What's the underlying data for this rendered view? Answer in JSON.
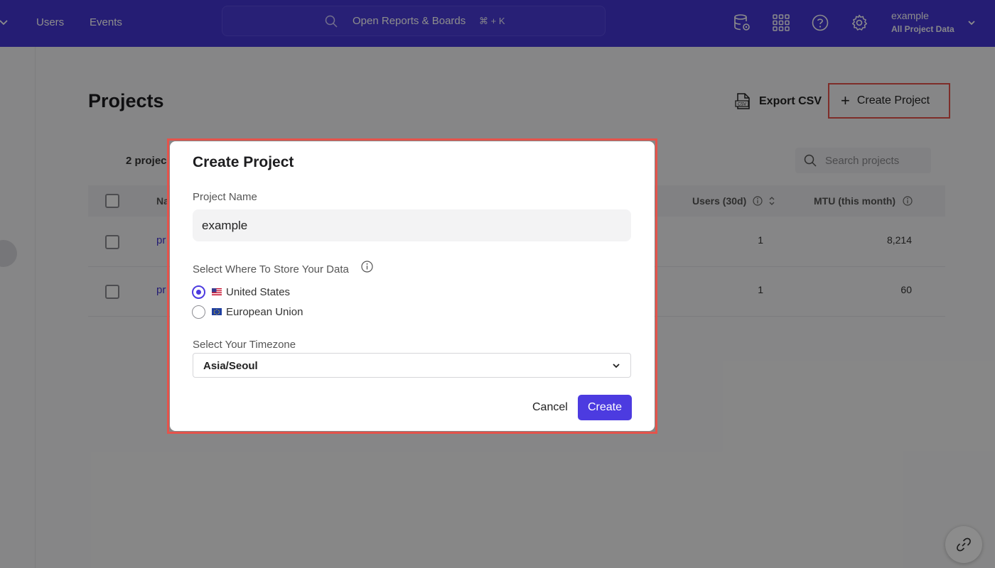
{
  "topbar": {
    "nav": [
      "Users",
      "Events"
    ],
    "search_text": "Open Reports & Boards",
    "search_shortcut": "⌘ + K",
    "project_name": "example",
    "project_scope": "All Project Data",
    "icons": [
      "data-icon",
      "apps-grid-icon",
      "help-icon",
      "gear-icon"
    ]
  },
  "page": {
    "title": "Projects",
    "export_label": "Export CSV",
    "create_label": "Create Project",
    "count_text": "2 projec",
    "search_placeholder": "Search projects"
  },
  "table": {
    "headers": {
      "name": "Na",
      "users": "Users (30d)",
      "mtu": "MTU (this month)"
    },
    "rows": [
      {
        "name": "pr",
        "users": "1",
        "mtu": "8,214"
      },
      {
        "name": "pr",
        "users": "1",
        "mtu": "60"
      }
    ]
  },
  "modal": {
    "title": "Create Project",
    "name_label": "Project Name",
    "name_value": "example",
    "storage_label": "Select Where To Store Your Data",
    "storage_options": [
      {
        "flag": "us-flag-icon",
        "label": "United States",
        "selected": true
      },
      {
        "flag": "eu-flag-icon",
        "label": "European Union",
        "selected": false
      }
    ],
    "timezone_label": "Select Your Timezone",
    "timezone_value": "Asia/Seoul",
    "cancel_label": "Cancel",
    "create_label": "Create"
  },
  "colors": {
    "brand": "#4435d4",
    "primary_button": "#4c3be0",
    "highlight_outline": "#e5534b"
  }
}
